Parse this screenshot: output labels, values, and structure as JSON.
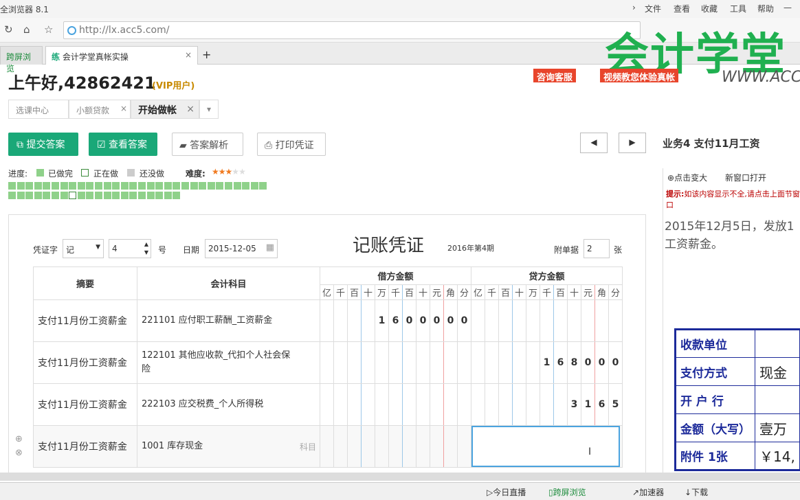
{
  "browser": {
    "title": "全浏览器 8.1",
    "menu": [
      "文件",
      "查看",
      "收藏",
      "工具",
      "帮助"
    ],
    "url": "http://lx.acc5.com/",
    "tabs": [
      "跨屏浏览",
      "会计学堂真帐实操"
    ],
    "tab_icon": "练",
    "status": {
      "live": "今日直播",
      "cross": "跨屏浏览",
      "accel": "加速器",
      "download": "下载"
    }
  },
  "watermark": {
    "main": "会计学堂",
    "sub": "WWW.ACC"
  },
  "header": {
    "greeting": "上午好,42862421",
    "vip": "(VIP用户)",
    "btn_consult": "咨询客服",
    "btn_video": "视频教您体验真帐"
  },
  "page_tabs": [
    "选课中心",
    "小额贷款",
    "开始做帐"
  ],
  "toolbar": {
    "submit": "提交答案",
    "view": "查看答案",
    "analysis": "答案解析",
    "print": "打印凭证"
  },
  "progress": {
    "label": "进度:",
    "done": "已做完",
    "doing": "正在做",
    "todo": "还没做",
    "difficulty": "难度:",
    "stars": 3,
    "max_stars": 5,
    "row1_count": 30,
    "row2_count": 20,
    "current_index": 7
  },
  "voucher": {
    "title": "记账凭证",
    "period": "2016年第4期",
    "word_label": "凭证字",
    "word_value": "记",
    "num_value": "4",
    "num_label": "号",
    "date_label": "日期",
    "date_value": "2015-12-05",
    "attach_label": "附单据",
    "attach_value": "2",
    "attach_unit": "张",
    "col_summary": "摘要",
    "col_account": "会计科目",
    "col_debit": "借方金额",
    "col_credit": "贷方金额",
    "digit_heads": [
      "亿",
      "千",
      "百",
      "十",
      "万",
      "千",
      "百",
      "十",
      "元",
      "角",
      "分"
    ],
    "subject_hint": "科目",
    "rows": [
      {
        "summary": "支付11月份工资薪金",
        "account": "221101 应付职工薪酬_工资薪金",
        "debit": "1600000",
        "credit": ""
      },
      {
        "summary": "支付11月份工资薪金",
        "account": "122101 其他应收款_代扣个人社会保险",
        "debit": "",
        "credit": "168000"
      },
      {
        "summary": "支付11月份工资薪金",
        "account": "222103 应交税费_个人所得税",
        "debit": "",
        "credit": "3165"
      },
      {
        "summary": "支付11月份工资薪金",
        "account": "1001 库存现金",
        "debit": "",
        "credit": ""
      }
    ]
  },
  "right": {
    "title": "业务4 支付11月工资",
    "zoom": "点击变大",
    "newwin": "新窗口打开",
    "tip_label": "提示:",
    "tip": "如该内容显示不全,请点击上面节窗口",
    "desc": "2015年12月5日，发放1工资薪金。",
    "table": [
      [
        "收款单位",
        ""
      ],
      [
        "支付方式",
        "现金"
      ],
      [
        "开 户 行",
        ""
      ],
      [
        "金额（大写）",
        "壹万"
      ],
      [
        "附件 1张",
        "￥14,"
      ]
    ]
  }
}
